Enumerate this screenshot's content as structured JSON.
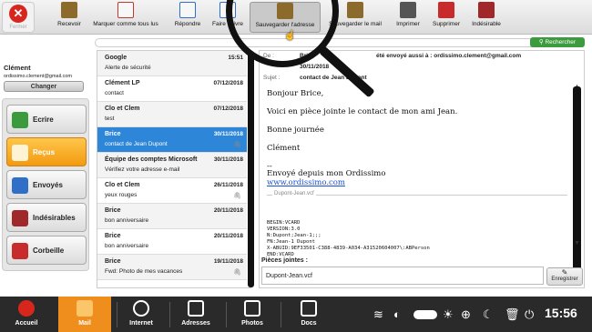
{
  "toolbar": {
    "close_label": "Fermer",
    "buttons": [
      {
        "label": "Recevoir",
        "icon": "receive-icon",
        "color": "#8c6a2c"
      },
      {
        "label": "Marquer comme tous lus",
        "icon": "mark-read-icon",
        "color": "#c0392b"
      },
      {
        "label": "Répondre",
        "icon": "reply-icon",
        "color": "#2f6fc7"
      },
      {
        "label": "Faire suivre",
        "icon": "forward-icon",
        "color": "#2f6fc7"
      },
      {
        "label": "Sauvegarder l'adresse",
        "icon": "save-address-icon",
        "color": "#8c6a2c"
      },
      {
        "label": "Sauvegarder le mail",
        "icon": "save-mail-icon",
        "color": "#8c6a2c"
      },
      {
        "label": "Imprimer",
        "icon": "printer-icon",
        "color": "#444"
      },
      {
        "label": "Supprimer",
        "icon": "trash-icon",
        "color": "#c72b2b"
      },
      {
        "label": "Indésirable",
        "icon": "spam-icon",
        "color": "#a0282b"
      }
    ]
  },
  "search": {
    "button_label": "Rechercher"
  },
  "account": {
    "name": "Clément",
    "email": "ordissimo.clement@gmail.com",
    "change_label": "Changer"
  },
  "folders": [
    {
      "label": "Ecrire",
      "icon": "write-icon",
      "color": "#3b9a3b"
    },
    {
      "label": "Reçus",
      "icon": "inbox-icon",
      "color": "#f5a623"
    },
    {
      "label": "Envoyés",
      "icon": "sent-icon",
      "color": "#2f6fc7"
    },
    {
      "label": "Indésirables",
      "icon": "spam-folder-icon",
      "color": "#a0282b"
    },
    {
      "label": "Corbeille",
      "icon": "trash-folder-icon",
      "color": "#c72b2b"
    }
  ],
  "messages": [
    {
      "from": "Google",
      "date": "15:51",
      "subject": "Alerte de sécurité",
      "attachment": false
    },
    {
      "from": "Clément LP",
      "date": "07/12/2018",
      "subject": "contact",
      "attachment": false
    },
    {
      "from": "Clo et Clem",
      "date": "07/12/2018",
      "subject": "test",
      "attachment": false
    },
    {
      "from": "Brice",
      "date": "30/11/2018",
      "subject": "contact de Jean Dupont",
      "attachment": true,
      "selected": true
    },
    {
      "from": "Équipe des comptes Microsoft",
      "date": "30/11/2018",
      "subject": "Vérifiez votre adresse e-mail",
      "attachment": false
    },
    {
      "from": "Clo et Clem",
      "date": "26/11/2018",
      "subject": "yeux rouges",
      "attachment": true
    },
    {
      "from": "Brice",
      "date": "20/11/2018",
      "subject": "bon anniversaire",
      "attachment": false
    },
    {
      "from": "Brice",
      "date": "20/11/2018",
      "subject": "bon anniversaire",
      "attachment": false
    },
    {
      "from": "Brice",
      "date": "19/11/2018",
      "subject": "Fwd: Photo de mes vacances",
      "attachment": true
    }
  ],
  "reader": {
    "from_key": "De :",
    "from_val": "Brice",
    "sent_note": "été envoyé aussi à : ordissimo.clement@gmail.com",
    "date_val": "30/11/2018",
    "to_val": "Clément",
    "subject_key": "Sujet :",
    "subject_val": "contact de Jean Dupont",
    "body": {
      "greeting": "Bonjour Brice,",
      "line1": "Voici en pièce jointe le contact de mon ami Jean.",
      "line2": "Bonne journée",
      "signature": "Clément",
      "dashes": "--",
      "footer": "Envoyé depuis mon Ordissimo",
      "link": "www.ordissimo.com"
    },
    "vcard": {
      "name": "Dupont-Jean.vcf",
      "lines": [
        "BEGIN:VCARD",
        "VERSION:3.0",
        "N:Dupont;Jean-1;;;",
        "FN:Jean-1 Dupont",
        "X-ABUID:9EF33501-C388-4839-A034-A31520604007\\:ABPerson",
        "END:VCARD"
      ]
    },
    "attachments_title": "Pièces jointes :",
    "attachment_file": "Dupont-Jean.vcf",
    "save_label": "Enregistrer"
  },
  "bottom_nav": [
    {
      "label": "Accueil",
      "icon": "home-icon",
      "color": "#d7261d"
    },
    {
      "label": "Mail",
      "icon": "mail-icon",
      "color": "#f7b041",
      "active": true
    },
    {
      "label": "Internet",
      "icon": "globe-icon",
      "color": "#ffffff"
    },
    {
      "label": "Adresses",
      "icon": "contacts-icon",
      "color": "#ffffff"
    },
    {
      "label": "Photos",
      "icon": "camera-icon",
      "color": "#ffffff"
    },
    {
      "label": "Docs",
      "icon": "docs-icon",
      "color": "#ffffff"
    }
  ],
  "status": {
    "clock": "15:56"
  }
}
